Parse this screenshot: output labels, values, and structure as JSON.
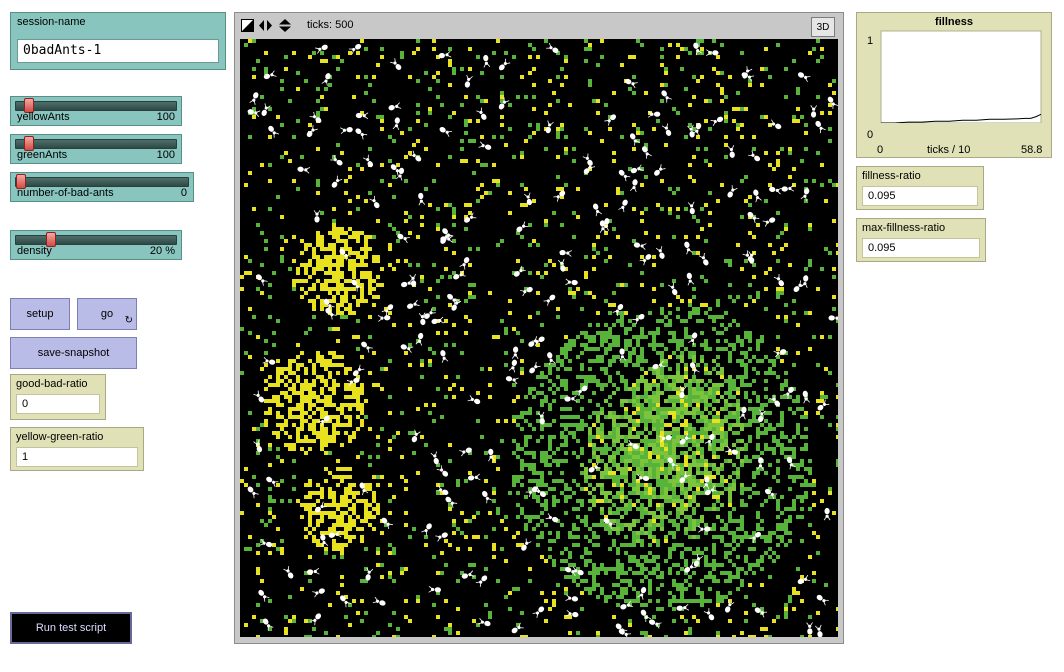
{
  "session": {
    "label": "session-name",
    "value": "0badAnts-1"
  },
  "sliders": [
    {
      "name": "yellowAnts",
      "value": "100",
      "fraction": 0.05
    },
    {
      "name": "greenAnts",
      "value": "100",
      "fraction": 0.05
    },
    {
      "name": "number-of-bad-ants",
      "value": "0",
      "fraction": 0.0
    },
    {
      "name": "density",
      "value": "20 %",
      "fraction": 0.2
    }
  ],
  "buttons": {
    "setup": "setup",
    "go": "go",
    "go_forever_icon": "↻",
    "save_snapshot": "save-snapshot",
    "run_test_script": "Run test script"
  },
  "monitors": {
    "good_bad_ratio": {
      "label": "good-bad-ratio",
      "value": "0"
    },
    "yellow_green_ratio": {
      "label": "yellow-green-ratio",
      "value": "1"
    },
    "fillness_ratio": {
      "label": "fillness-ratio",
      "value": "0.095"
    },
    "max_fillness_ratio": {
      "label": "max-fillness-ratio",
      "value": "0.095"
    }
  },
  "view": {
    "ticks": "ticks: 500",
    "btn3d": "3D",
    "toolbar_icons": [
      "edit-icon",
      "horizontal-arrows-icon",
      "vertical-arrows-icon"
    ],
    "colors": {
      "background": "#000000",
      "yellow": "#e8e11e",
      "green": "#58b33a",
      "lightgreen": "#7cc43c",
      "ant": "#ffffff"
    }
  },
  "plot": {
    "title": "fillness",
    "xlabel": "ticks / 10",
    "xmin_label": "0",
    "xmax_label": "58.8",
    "ymin_label": "0",
    "ymax_label": "1",
    "chart_data": {
      "type": "line",
      "title": "fillness",
      "xlabel": "ticks / 10",
      "ylabel": "",
      "xlim": [
        0,
        58.8
      ],
      "ylim": [
        0,
        1
      ],
      "series": [
        {
          "x": [
            0,
            5,
            10,
            15,
            20,
            25,
            30,
            35,
            40,
            45,
            50,
            53,
            55,
            57,
            58.8
          ],
          "values": [
            0.0,
            0.0,
            0.01,
            0.01,
            0.02,
            0.02,
            0.03,
            0.03,
            0.04,
            0.04,
            0.045,
            0.05,
            0.05,
            0.07,
            0.095
          ]
        }
      ]
    }
  }
}
